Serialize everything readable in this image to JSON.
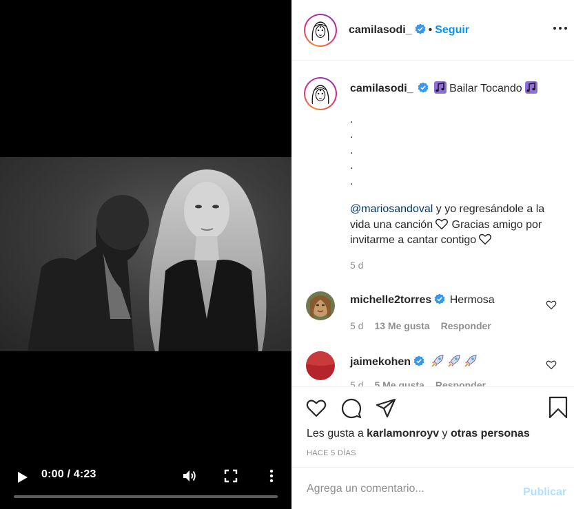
{
  "video": {
    "time_display": "0:00 / 4:23",
    "progress": 0.0,
    "icons": {
      "play": "play-icon",
      "volume": "volume-icon",
      "fullscreen": "fullscreen-icon",
      "more": "more-vertical-icon"
    }
  },
  "header": {
    "username": "camilasodi_",
    "separator": "•",
    "follow_label": "Seguir",
    "icons": {
      "verified": "verified-badge-icon",
      "options": "more-horizontal-icon"
    }
  },
  "caption": {
    "username": "camilasodi_",
    "title": "Bailar Tocando",
    "dots": [
      ".",
      ".",
      ".",
      ".",
      "."
    ],
    "mention": "@mariosandoval",
    "text_1": " y yo regresándole a la vida una canción",
    "text_2": " Gracias amigo por invitarme a cantar contigo",
    "time": "5 d",
    "icons": {
      "music": "musical-notes-icon",
      "heart": "heart-outline-icon"
    }
  },
  "comments": [
    {
      "username": "michelle2torres",
      "text": "Hermosa",
      "time": "5 d",
      "likes": "13 Me gusta",
      "reply": "Responder"
    },
    {
      "username": "jaimekohen",
      "text": "",
      "time": "5 d",
      "likes": "5 Me gusta",
      "reply": "Responder"
    }
  ],
  "actions": {
    "likes_prefix": "Les gusta a ",
    "likes_user": "karlamonroyv",
    "likes_middle": " y ",
    "likes_others": "otras personas",
    "posted_ago": "HACE 5 DÍAS",
    "icons": {
      "like": "heart-icon",
      "comment": "comment-icon",
      "share": "send-icon",
      "save": "bookmark-icon"
    }
  },
  "composer": {
    "placeholder": "Agrega un comentario...",
    "publish_label": "Publicar"
  },
  "colors": {
    "accent": "#0095f6",
    "publish_disabled": "#b2dffc",
    "secondary_text": "#8e8e8e",
    "mention": "#00376b",
    "video_bg": "#000000"
  }
}
